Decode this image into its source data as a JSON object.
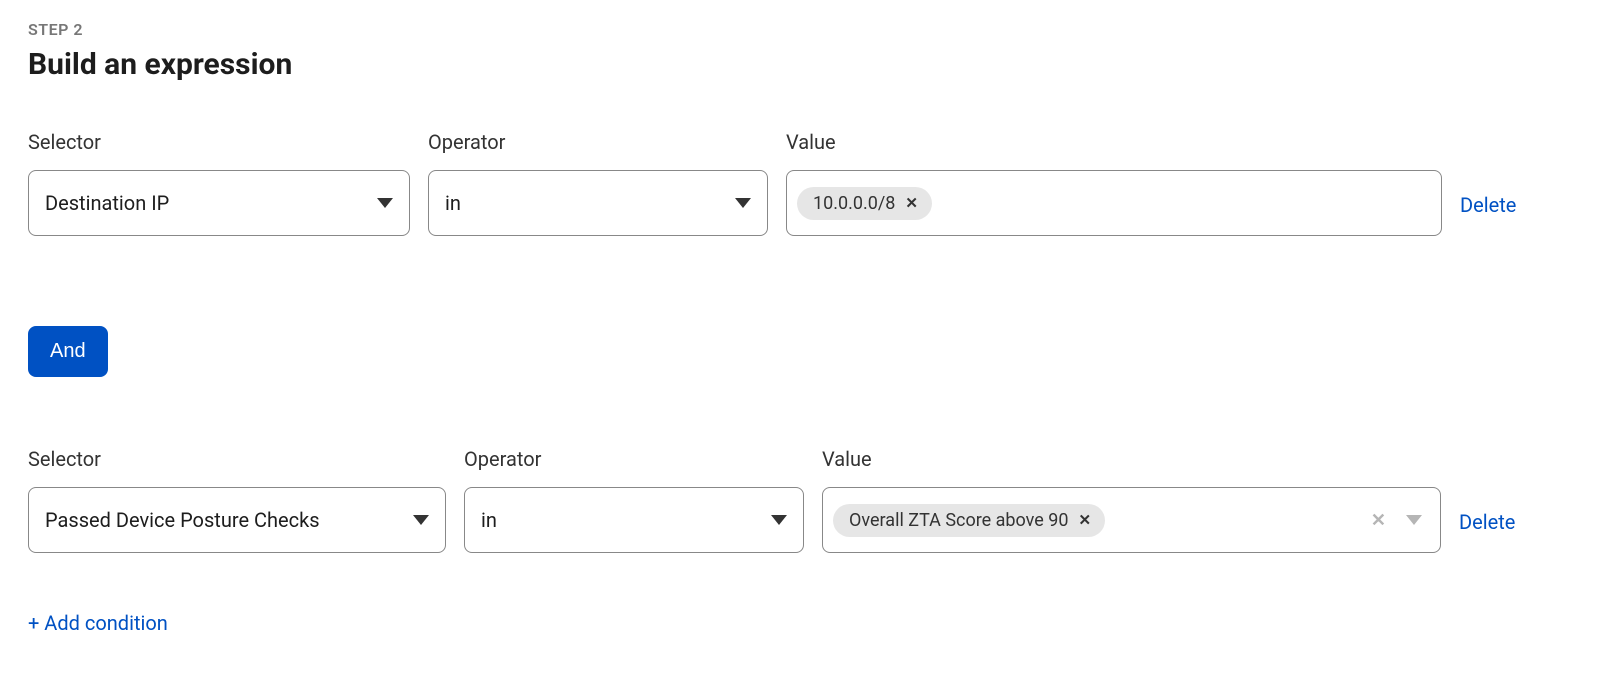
{
  "header": {
    "step_label": "STEP 2",
    "title": "Build an expression"
  },
  "labels": {
    "selector": "Selector",
    "operator": "Operator",
    "value": "Value",
    "delete": "Delete",
    "and": "And",
    "add_condition": "+ Add condition"
  },
  "rows": [
    {
      "selector": "Destination IP",
      "operator": "in",
      "value_chip": "10.0.0.0/8"
    },
    {
      "selector": "Passed Device Posture Checks",
      "operator": "in",
      "value_chip": "Overall ZTA Score above 90"
    }
  ]
}
